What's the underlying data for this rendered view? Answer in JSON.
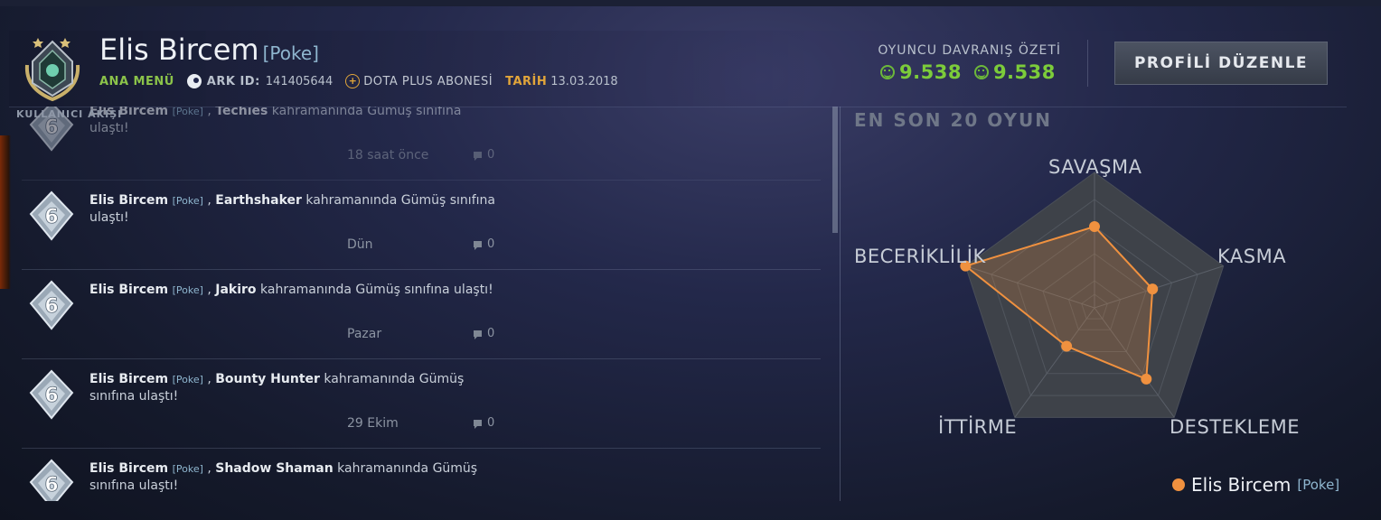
{
  "profile": {
    "name": "Elis Bircem",
    "tag": "[Poke]",
    "menu": "ANA MENÜ",
    "account_label": "ARK ID:",
    "account_id": "141405644",
    "plus_label": "DOTA PLUS ABONESİ",
    "date_label": "TARİH",
    "date": "13.03.2018"
  },
  "behavior": {
    "title": "OYUNCU DAVRANIŞ ÖZETİ",
    "score1": "9.538",
    "score2": "9.538"
  },
  "edit_button": "PROFİLİ DÜZENLE",
  "feed": {
    "label": "KULLANICI AKIŞI",
    "items": [
      {
        "name": "Elis Bircem",
        "tag": "[Poke]",
        "sep": ",",
        "hero": "Techies",
        "rest": "kahramanında Gümüş sınıfına ulaştı!",
        "time": "18 saat önce",
        "comments": "0",
        "rank": "6"
      },
      {
        "name": "Elis Bircem",
        "tag": "[Poke]",
        "sep": ",",
        "hero": "Earthshaker",
        "rest": "kahramanında Gümüş sınıfına ulaştı!",
        "time": "Dün",
        "comments": "0",
        "rank": "6"
      },
      {
        "name": "Elis Bircem",
        "tag": "[Poke]",
        "sep": ",",
        "hero": "Jakiro",
        "rest": "kahramanında Gümüş sınıfına ulaştı!",
        "time": "Pazar",
        "comments": "0",
        "rank": "6"
      },
      {
        "name": "Elis Bircem",
        "tag": "[Poke]",
        "sep": ",",
        "hero": "Bounty Hunter",
        "rest": "kahramanında Gümüş sınıfına ulaştı!",
        "time": "29 Ekim",
        "comments": "0",
        "rank": "6"
      },
      {
        "name": "Elis Bircem",
        "tag": "[Poke]",
        "sep": ",",
        "hero": "Shadow Shaman",
        "rest": "kahramanında Gümüş sınıfına ulaştı!",
        "time": "",
        "comments": "",
        "rank": "6"
      }
    ]
  },
  "radar": {
    "title": "EN SON 20 OYUN",
    "axes": [
      "SAVAŞMA",
      "KASMA",
      "DESTEKLEME",
      "İTTİRME",
      "BECERİKLİLİK"
    ],
    "legend_name": "Elis Bircem",
    "legend_tag": "[Poke]"
  },
  "chart_data": {
    "type": "radar",
    "axes": [
      "SAVAŞMA",
      "KASMA",
      "DESTEKLEME",
      "İTTİRME",
      "BECERİKLİLİK"
    ],
    "range": [
      0,
      1
    ],
    "series": [
      {
        "name": "Elis Bircem [Poke]",
        "values": [
          0.6,
          0.45,
          0.65,
          0.35,
          1.0
        ],
        "color": "#f0913f"
      }
    ]
  },
  "colors": {
    "accent_green": "#7ccc3a",
    "accent_orange": "#f0913f",
    "gold": "#e1a53a"
  }
}
